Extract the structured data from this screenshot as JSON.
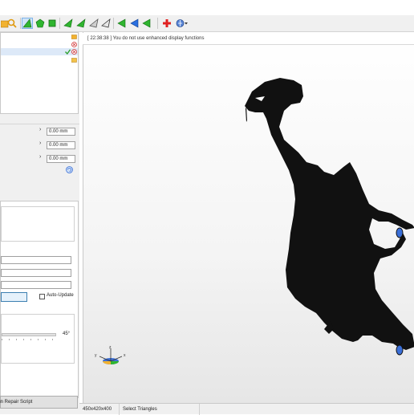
{
  "toolbar": {
    "icons": [
      "folder-icon",
      "magnifier-icon",
      "select-triangle-icon",
      "green-pentagon-icon",
      "green-cube-icon",
      "green-arrow-left-icon",
      "green-arrow-left-2-icon",
      "gray-arrow-icon",
      "gray-arrow-2-icon",
      "green-arrow-3-icon",
      "blue-arrow-icon",
      "blue-arrow-2-icon",
      "red-cross-icon",
      "globe-dropdown-icon"
    ]
  },
  "message_bar": {
    "text": "[ 22:38:38 ] You do not use enhanced display functions"
  },
  "properties": {
    "rows": [
      {
        "value": "0.00 mm"
      },
      {
        "value": "0.00 mm"
      },
      {
        "value": "0.00 mm"
      }
    ]
  },
  "tool_panel": {
    "auto_update_label": "Auto-Update",
    "slider_value": "45°",
    "run_button_label": "Run Repair Script"
  },
  "status_bar": {
    "viewport_size": "450x420x400",
    "mode": "Select Triangles"
  },
  "colors": {
    "accent": "#3a6fd8",
    "model": "#111111"
  }
}
